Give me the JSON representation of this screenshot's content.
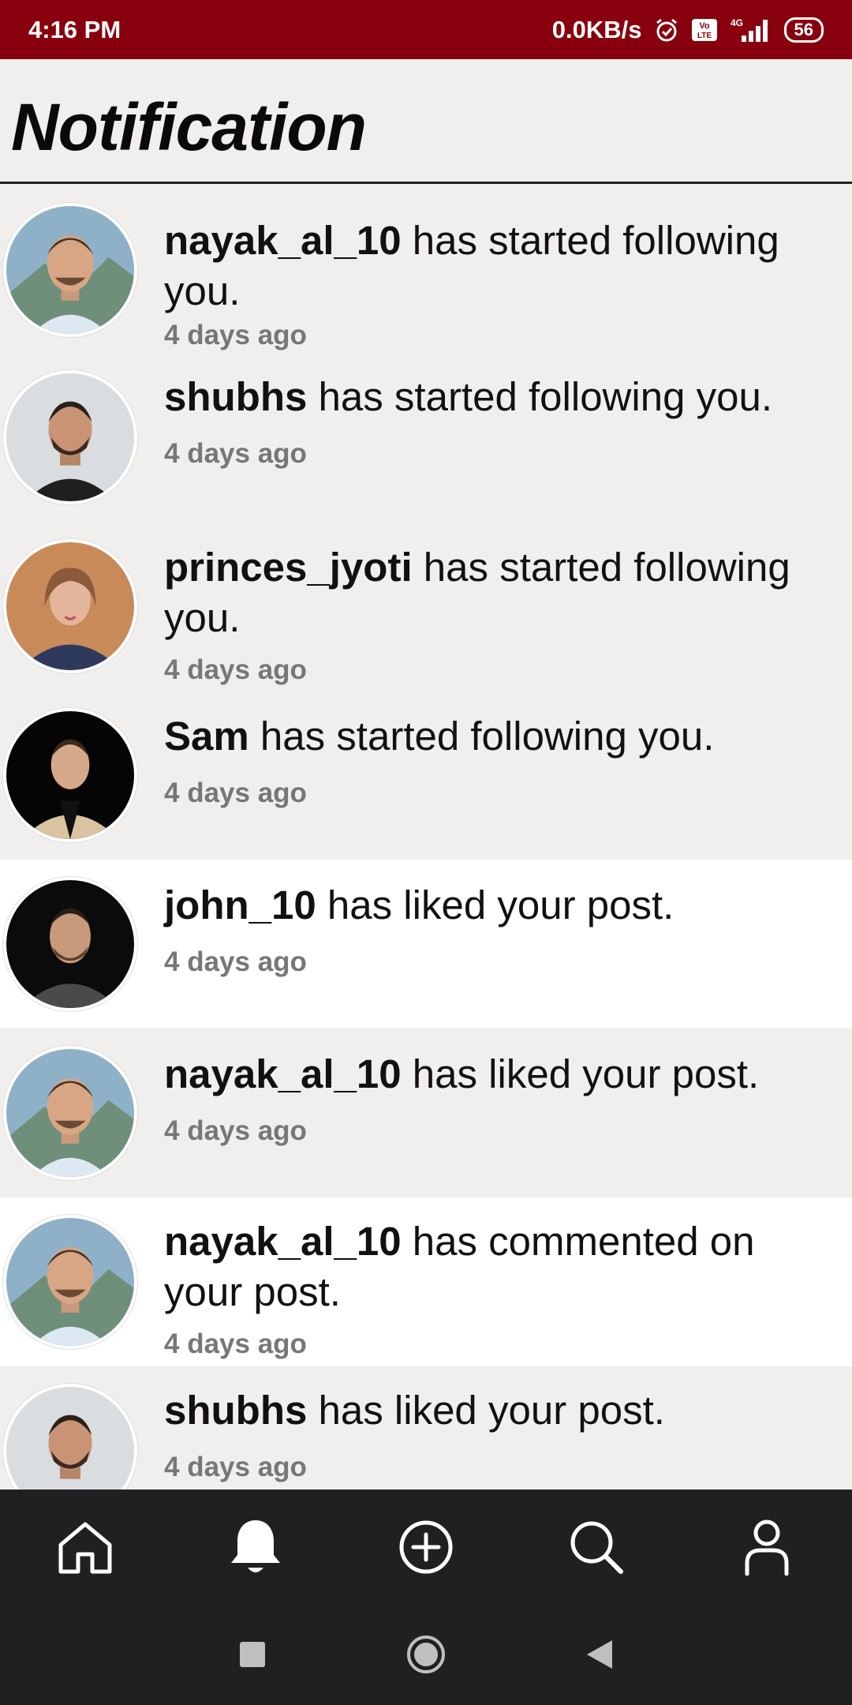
{
  "status_bar": {
    "time": "4:16 PM",
    "net_speed": "0.0KB/s",
    "volte": "Vo LTE",
    "signal_label": "4G",
    "battery": "56"
  },
  "header": {
    "title": "Notification"
  },
  "notifications": [
    {
      "user": "nayak_al_10",
      "action": " has started following you.",
      "time": "4 days ago",
      "avatar": "avatar-man-smiling"
    },
    {
      "user": "shubhs",
      "action": " has started following you.",
      "time": "4 days ago",
      "avatar": "avatar-man-beard"
    },
    {
      "user": "princes_jyoti",
      "action": " has started following you.",
      "time": "4 days ago",
      "avatar": "avatar-woman"
    },
    {
      "user": "Sam",
      "action": " has started following you.",
      "time": "4 days ago",
      "avatar": "avatar-man-suit"
    },
    {
      "user": "john_10",
      "action": " has liked your post.",
      "time": "4 days ago",
      "avatar": "avatar-man-dark"
    },
    {
      "user": "nayak_al_10",
      "action": " has liked your post.",
      "time": "4 days ago",
      "avatar": "avatar-man-smiling"
    },
    {
      "user": "nayak_al_10",
      "action": " has commented on your post.",
      "time": "4 days ago",
      "avatar": "avatar-man-smiling"
    },
    {
      "user": "shubhs",
      "action": " has liked your post.",
      "time": "4 days ago",
      "avatar": "avatar-man-beard"
    }
  ],
  "bottom_nav": [
    {
      "icon": "home-icon"
    },
    {
      "icon": "bell-icon"
    },
    {
      "icon": "add-icon"
    },
    {
      "icon": "search-icon"
    },
    {
      "icon": "profile-icon"
    }
  ],
  "system_nav": [
    {
      "icon": "recents-icon"
    },
    {
      "icon": "home-circle-icon"
    },
    {
      "icon": "back-icon"
    }
  ],
  "colors": {
    "status_bar": "#88000d",
    "nav_bg": "#202020",
    "row_grey": "#f1eeee",
    "row_white": "#ffffff"
  }
}
